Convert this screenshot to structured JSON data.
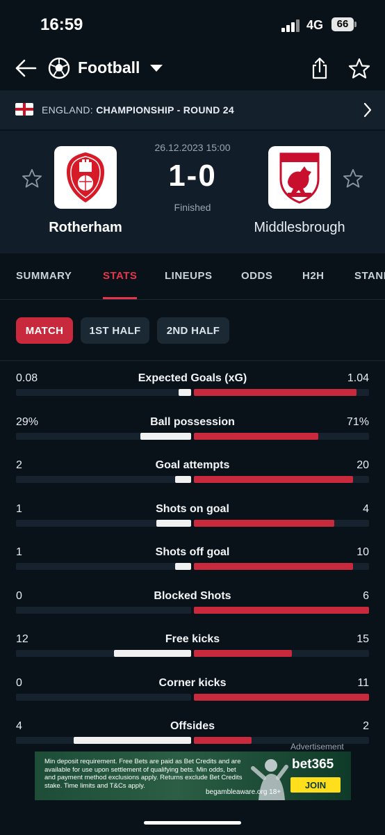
{
  "status_bar": {
    "time": "16:59",
    "network": "4G",
    "battery": "66"
  },
  "header": {
    "sport": "Football"
  },
  "league": {
    "country": "ENGLAND:",
    "competition": "CHAMPIONSHIP - ROUND 24"
  },
  "match": {
    "datetime": "26.12.2023 15:00",
    "score": "1-0",
    "status": "Finished",
    "home": {
      "name": "Rotherham"
    },
    "away": {
      "name": "Middlesbrough"
    }
  },
  "tabs": [
    {
      "label": "SUMMARY"
    },
    {
      "label": "STATS"
    },
    {
      "label": "LINEUPS"
    },
    {
      "label": "ODDS"
    },
    {
      "label": "H2H"
    },
    {
      "label": "STANDINGS"
    }
  ],
  "filters": [
    {
      "label": "MATCH"
    },
    {
      "label": "1ST HALF"
    },
    {
      "label": "2ND HALF"
    }
  ],
  "stats": [
    {
      "home": "0.08",
      "label": "Expected Goals (xG)",
      "away": "1.04",
      "home_frac": 0.07,
      "away_frac": 0.93
    },
    {
      "home": "29%",
      "label": "Ball possession",
      "away": "71%",
      "home_frac": 0.29,
      "away_frac": 0.71
    },
    {
      "home": "2",
      "label": "Goal attempts",
      "away": "20",
      "home_frac": 0.09,
      "away_frac": 0.91
    },
    {
      "home": "1",
      "label": "Shots on goal",
      "away": "4",
      "home_frac": 0.2,
      "away_frac": 0.8
    },
    {
      "home": "1",
      "label": "Shots off goal",
      "away": "10",
      "home_frac": 0.09,
      "away_frac": 0.91
    },
    {
      "home": "0",
      "label": "Blocked Shots",
      "away": "6",
      "home_frac": 0.0,
      "away_frac": 1.0
    },
    {
      "home": "12",
      "label": "Free kicks",
      "away": "15",
      "home_frac": 0.44,
      "away_frac": 0.56
    },
    {
      "home": "0",
      "label": "Corner kicks",
      "away": "11",
      "home_frac": 0.0,
      "away_frac": 1.0
    },
    {
      "home": "4",
      "label": "Offsides",
      "away": "2",
      "home_frac": 0.67,
      "away_frac": 0.33
    }
  ],
  "ad": {
    "label": "Advertisement",
    "text": "Min deposit requirement. Free Bets are paid as Bet Credits and are available for use upon settlement of qualifying bets. Min odds, bet and payment method exclusions apply. Returns exclude Bet Credits stake. Time limits and T&Cs apply.",
    "brand": "bet365",
    "cta": "JOIN",
    "aware": "begambleaware.org 18+"
  },
  "colors": {
    "accent": "#c8293c",
    "background": "#0a1219",
    "home_bar": "#f1f1f1",
    "away_bar": "#c8293c"
  },
  "icons": [
    "back-arrow-icon",
    "football-icon",
    "dropdown-caret-icon",
    "share-icon",
    "star-icon",
    "england-flag-icon",
    "chevron-right-icon",
    "favorite-star-icon",
    "rotherham-crest-icon",
    "middlesbrough-crest-icon"
  ]
}
